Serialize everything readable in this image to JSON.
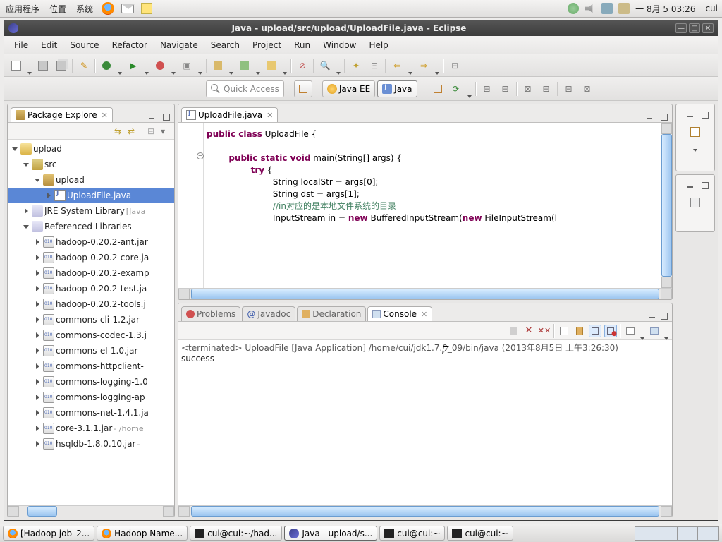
{
  "gnome": {
    "menus": [
      "应用程序",
      "位置",
      "系统"
    ],
    "clock": "一 8月  5 03:26",
    "user": "cui"
  },
  "window": {
    "title": "Java - upload/src/upload/UploadFile.java - Eclipse"
  },
  "menubar": [
    "File",
    "Edit",
    "Source",
    "Refactor",
    "Navigate",
    "Search",
    "Project",
    "Run",
    "Window",
    "Help"
  ],
  "quick_access": {
    "placeholder": "Quick Access"
  },
  "perspectives": {
    "jee": "Java EE",
    "java": "Java"
  },
  "views": {
    "pkg_explorer_title": "Package Explore",
    "editor_tab": "UploadFile.java",
    "problems": "Problems",
    "javadoc": "Javadoc",
    "declaration": "Declaration",
    "console": "Console"
  },
  "tree": {
    "project": "upload",
    "src": "src",
    "pkg": "upload",
    "file": "UploadFile.java",
    "jre": "JRE System Library",
    "jre_decor": "[Java",
    "reflib": "Referenced Libraries",
    "jars": [
      "hadoop-0.20.2-ant.jar",
      "hadoop-0.20.2-core.ja",
      "hadoop-0.20.2-examp",
      "hadoop-0.20.2-test.ja",
      "hadoop-0.20.2-tools.j",
      "commons-cli-1.2.jar",
      "commons-codec-1.3.j",
      "commons-el-1.0.jar",
      "commons-httpclient-",
      "commons-logging-1.0",
      "commons-logging-ap",
      "commons-net-1.4.1.ja",
      "core-3.1.1.jar",
      "hsqldb-1.8.0.10.jar"
    ],
    "jar_decor": " - /home"
  },
  "code": {
    "line1a": "public",
    "line1b": " class",
    "line1c": " UploadFile {",
    "line2a": "public",
    "line2b": " static",
    "line2c": " void",
    "line2d": " main(String[] args) {",
    "line3a": "try",
    "line3b": " {",
    "line4": "String localStr = args[0];",
    "line5": "String dst = args[1];",
    "line6": "//in对应的是本地文件系统的目录",
    "line7a": "InputStream in = ",
    "line7b": "new",
    "line7c": " BufferedInputStream(",
    "line7d": "new",
    "line7e": " FileInputStream(l"
  },
  "console": {
    "header": "<terminated> UploadFile [Java Application] /home/cui/jdk1.7.0_09/bin/java (2013年8月5日 上午3:26:30)",
    "out": "success"
  },
  "taskbar": {
    "t1": "[Hadoop job_2...",
    "t2": "Hadoop Name...",
    "t3": "cui@cui:~/had...",
    "t4": "Java - upload/s...",
    "t5": "cui@cui:~",
    "t6": "cui@cui:~"
  }
}
